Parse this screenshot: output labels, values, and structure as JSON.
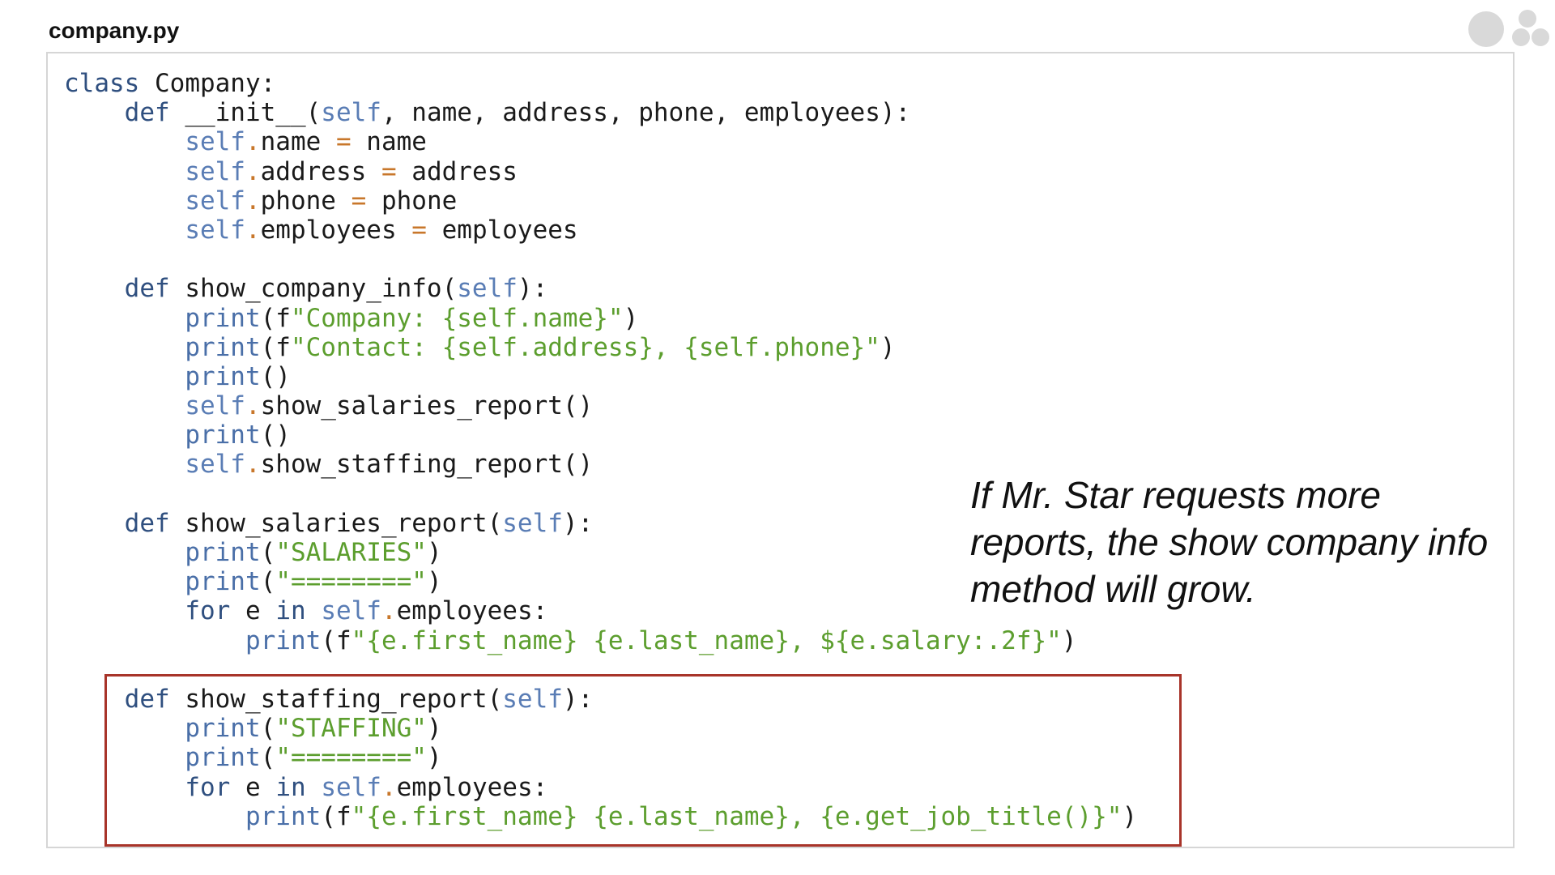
{
  "file": {
    "title": "company.py"
  },
  "icons": {
    "window_controls": "circle-dots-icon"
  },
  "colors": {
    "keyword": "#2f4f7f",
    "self": "#5a7db5",
    "operator": "#c8772b",
    "builtin": "#4a6fa8",
    "string": "#5c9e2e",
    "highlight_border": "#a8342a"
  },
  "code": {
    "tokens": {
      "class_kw": "class",
      "class_name": " Company:",
      "init_def": "def",
      "init_sig_a": " __init__(",
      "init_self": "self",
      "init_sig_b": ", name, address, phone, employees):",
      "a1_self": "self",
      "a1_dot": ".",
      "a1_attr": "name ",
      "a1_eq": "=",
      "a1_val": " name",
      "a2_self": "self",
      "a2_dot": ".",
      "a2_attr": "address ",
      "a2_eq": "=",
      "a2_val": " address",
      "a3_self": "self",
      "a3_dot": ".",
      "a3_attr": "phone ",
      "a3_eq": "=",
      "a3_val": " phone",
      "a4_self": "self",
      "a4_dot": ".",
      "a4_attr": "employees ",
      "a4_eq": "=",
      "a4_val": " employees",
      "sci_def": "def",
      "sci_name": " show_company_info(",
      "sci_self": "self",
      "sci_end": "):",
      "p1_fn": "print",
      "p1_open": "(f",
      "p1_str": "\"Company: {self.name}\"",
      "p1_close": ")",
      "p2_fn": "print",
      "p2_open": "(f",
      "p2_str": "\"Contact: {self.address}, {self.phone}\"",
      "p2_close": ")",
      "p3_fn": "print",
      "p3_rest": "()",
      "c1_self": "self",
      "c1_dot": ".",
      "c1_call": "show_salaries_report()",
      "p4_fn": "print",
      "p4_rest": "()",
      "c2_self": "self",
      "c2_dot": ".",
      "c2_call": "show_staffing_report()",
      "ssr_def": "def",
      "ssr_name": " show_salaries_report(",
      "ssr_self": "self",
      "ssr_end": "):",
      "s1_fn": "print",
      "s1_open": "(",
      "s1_str": "\"SALARIES\"",
      "s1_close": ")",
      "s2_fn": "print",
      "s2_open": "(",
      "s2_str": "\"========\"",
      "s2_close": ")",
      "sf_for": "for",
      "sf_e": " e ",
      "sf_in": "in",
      "sf_sp": " ",
      "sf_self": "self",
      "sf_dot": ".",
      "sf_rest": "employees:",
      "sp_fn": "print",
      "sp_open": "(f",
      "sp_str": "\"{e.first_name} {e.last_name}, ${e.salary:.2f}\"",
      "sp_close": ")",
      "str_def": "def",
      "str_name": " show_staffing_report(",
      "str_self": "self",
      "str_end": "):",
      "t1_fn": "print",
      "t1_open": "(",
      "t1_str": "\"STAFFING\"",
      "t1_close": ")",
      "t2_fn": "print",
      "t2_open": "(",
      "t2_str": "\"========\"",
      "t2_close": ")",
      "tf_for": "for",
      "tf_e": " e ",
      "tf_in": "in",
      "tf_sp": " ",
      "tf_self": "self",
      "tf_dot": ".",
      "tf_rest": "employees:",
      "tp_fn": "print",
      "tp_open": "(f",
      "tp_str": "\"{e.first_name} {e.last_name}, {e.get_job_title()}\"",
      "tp_close": ")"
    }
  },
  "annotation": {
    "note": "If Mr. Star requests more reports, the show company info method will grow."
  }
}
